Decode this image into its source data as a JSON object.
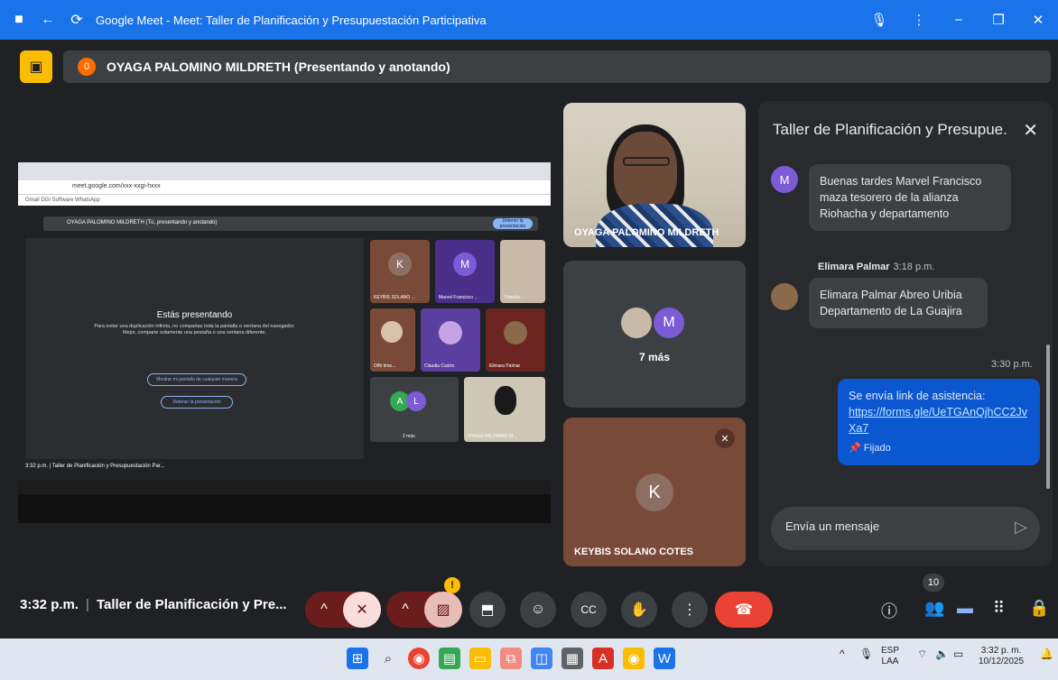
{
  "window": {
    "title": "Google Meet - Meet: Taller de Planificación y Presupuestación Participativa",
    "icons": [
      "meet-app-icon",
      "back-icon",
      "reload-icon",
      "mic-icon",
      "more-icon",
      "minimize-icon",
      "maximize-icon",
      "close-icon"
    ]
  },
  "banner": {
    "badge": "0",
    "text": "OYAGA PALOMINO MILDRETH (Presentando y anotando)"
  },
  "presentation": {
    "url": "meet.google.com/xxx-xxgi-hxxx",
    "bookmarks": "Gmail   DGI Software   WhatsApp",
    "mini_banner": "OYAGA PALOMINO MILDRETH (Tú, presentando y anotando)",
    "mini_stop": "Detener la presentación",
    "presenting_title": "Estás presentando",
    "presenting_text": "Para evitar una duplicación infinita, no compartas toda la pantalla o ventana del navegador. Mejor, comparte solamente una pestaña o una ventana diferente.",
    "show_anyway": "Mostrar mi pantalla de cualquier manera",
    "stop_presenting": "Detener la presentación",
    "tiles": [
      {
        "letter": "K",
        "label": "KEYBIS SOLANO ..."
      },
      {
        "letter": "M",
        "label": "Marvel Francisco ..."
      },
      {
        "letter": "",
        "label": "Yolanda ..."
      },
      {
        "letter": "",
        "label": "Offir time..."
      },
      {
        "letter": "",
        "label": "Claudia Castro"
      },
      {
        "letter": "",
        "label": "Elimara Palmar"
      },
      {
        "letter": "A",
        "label": ""
      },
      {
        "letter": "L",
        "label": "2 más"
      },
      {
        "letter": "",
        "label": "OYAGA PALOMINO M..."
      }
    ],
    "mini_clock": "3:32 p.m.  |  Taller de Planificación y Presupuestación Par..."
  },
  "tiles": {
    "presenter_name": "OYAGA PALOMINO MILDRETH",
    "more_letter": "M",
    "more_label": "7 más",
    "keybis_letter": "K",
    "keybis_name": "KEYBIS SOLANO COTES"
  },
  "chat": {
    "title": "Taller de Planificación y Presupue...",
    "close": "✕",
    "messages": [
      {
        "avatar": "M",
        "sender": "",
        "time": "",
        "text": "Buenas tardes Marvel Francisco maza tesorero de la alianza Riohacha y departamento"
      },
      {
        "avatar": "",
        "sender": "Elimara Palmar",
        "time": "3:18 p.m.",
        "text": "Elimara Palmar Abreo Uribia Departamento de La Guajira"
      }
    ],
    "own_message": {
      "time": "3:30 p.m.",
      "text": "Se envía link de asistencia:",
      "link": "https://forms.gle/UeTGAnQjhCC2JvXa7",
      "pinned": "Fijado"
    },
    "composer_placeholder": "Envía un mensaje"
  },
  "controls": {
    "clock": "3:32 p.m.",
    "meeting_title": "Taller de Planificación y Pre...",
    "participants_count": "10",
    "warning": "!"
  },
  "taskbar": {
    "lang_top": "ESP",
    "lang_bottom": "LAA",
    "time": "3:32 p. m.",
    "date": "10/12/2025"
  },
  "colors": {
    "accent": "#1a73e8",
    "meet_bg": "#202124",
    "tile_bg": "#3c4043",
    "hangup": "#ea4335",
    "avatar_purple": "#7b5cd6",
    "avatar_green": "#34a853"
  }
}
